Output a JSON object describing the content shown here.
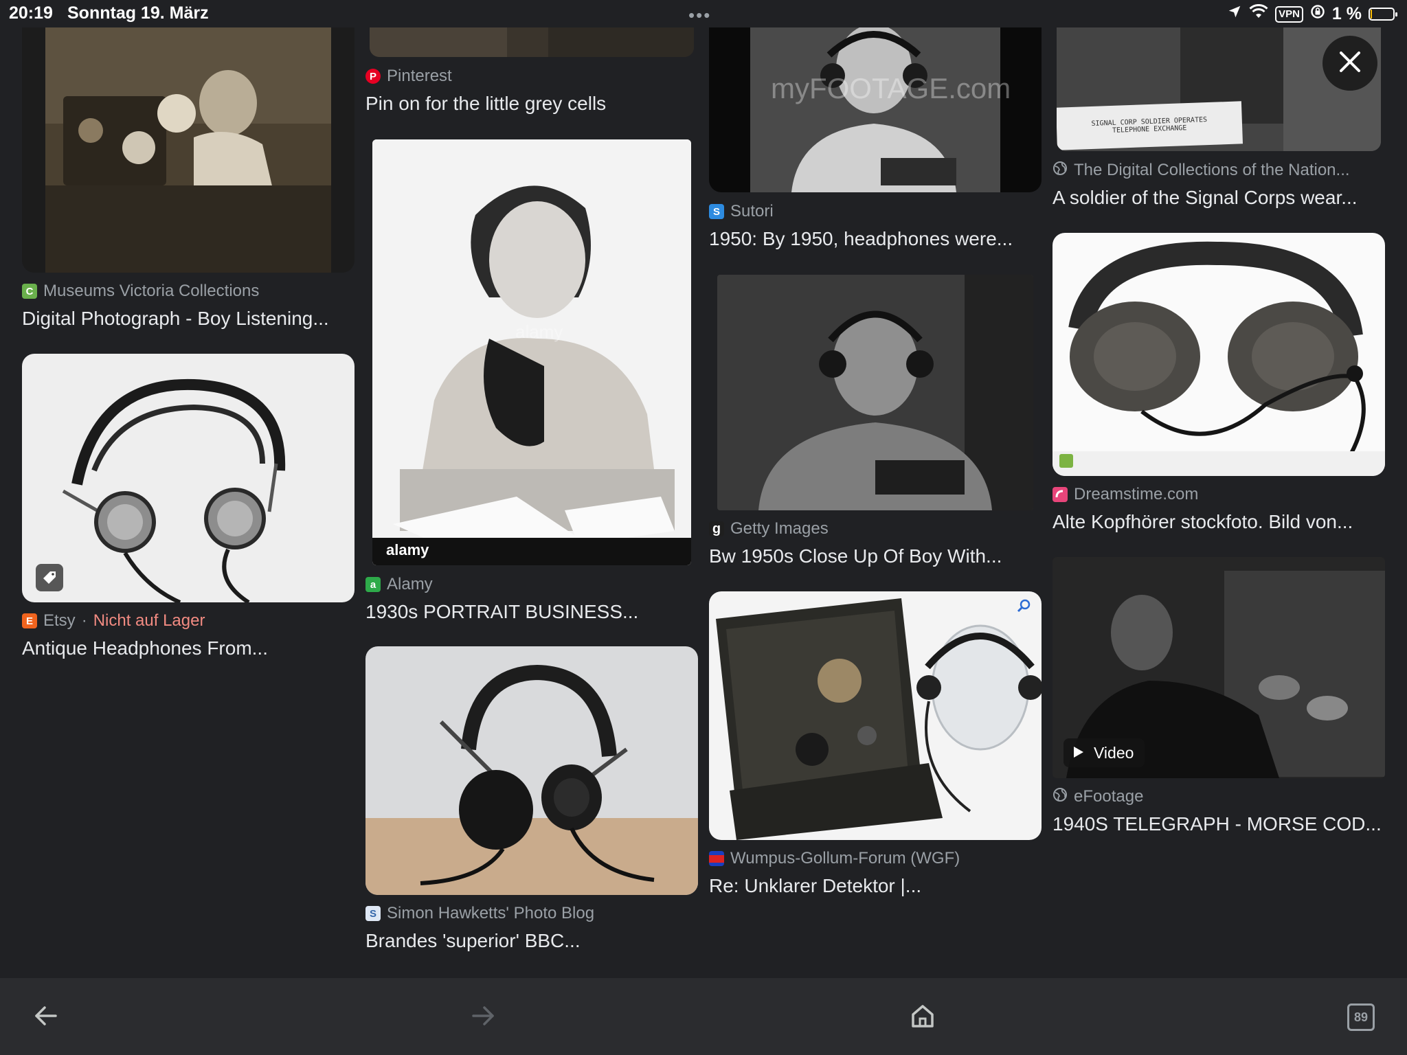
{
  "status": {
    "time": "20:19",
    "date": "Sonntag 19. März",
    "dots": "•••",
    "vpn": "VPN",
    "battery": "1 %",
    "battery_level": 0.01
  },
  "results": [
    {
      "source": "Museums Victoria Collections",
      "title": "Digital Photograph - Boy Listening..."
    },
    {
      "source": "Etsy",
      "stock": "Nicht auf Lager",
      "title": "Antique Headphones From..."
    },
    {
      "source": "Pinterest",
      "title": "Pin on for the little grey cells"
    },
    {
      "source": "Alamy",
      "title": "1930s PORTRAIT BUSINESS...",
      "watermark_top": "alamy",
      "watermark_bottom": "alamy"
    },
    {
      "source": "Simon Hawketts' Photo Blog",
      "title": "Brandes 'superior' BBC..."
    },
    {
      "source": "Sutori",
      "title": "1950: By 1950, headphones were...",
      "watermark": "myFOOTAGE.com"
    },
    {
      "source": "Getty Images",
      "title": "Bw 1950s Close Up Of Boy With..."
    },
    {
      "source": "Wumpus-Gollum-Forum (WGF)",
      "title": "Re: Unklarer Detektor |..."
    },
    {
      "source": "The Digital Collections of the Nation...",
      "title": "A soldier of the Signal Corps wear...",
      "caption_line1": "SIGNAL CORP SOLDIER OPERATES",
      "caption_line2": "TELEPHONE EXCHANGE"
    },
    {
      "source": "Dreamstime.com",
      "title": "Alte Kopfhörer stockfoto. Bild von..."
    },
    {
      "source": "eFootage",
      "title": "1940S TELEGRAPH - MORSE COD...",
      "badge": "Video"
    }
  ],
  "nav": {
    "tab_count": "89"
  },
  "icons": [
    "back-arrow-icon",
    "forward-arrow-icon",
    "home-icon",
    "tabs-icon",
    "close-icon",
    "tag-icon",
    "play-icon",
    "location-icon",
    "wifi-icon",
    "battery-icon",
    "lock-rotation-icon",
    "globe-icon"
  ],
  "colors": {
    "background": "#202124",
    "text": "#e8eaed",
    "muted": "#9aa0a6",
    "warning": "#f28b82",
    "nav_bar": "#2b2c2f"
  }
}
